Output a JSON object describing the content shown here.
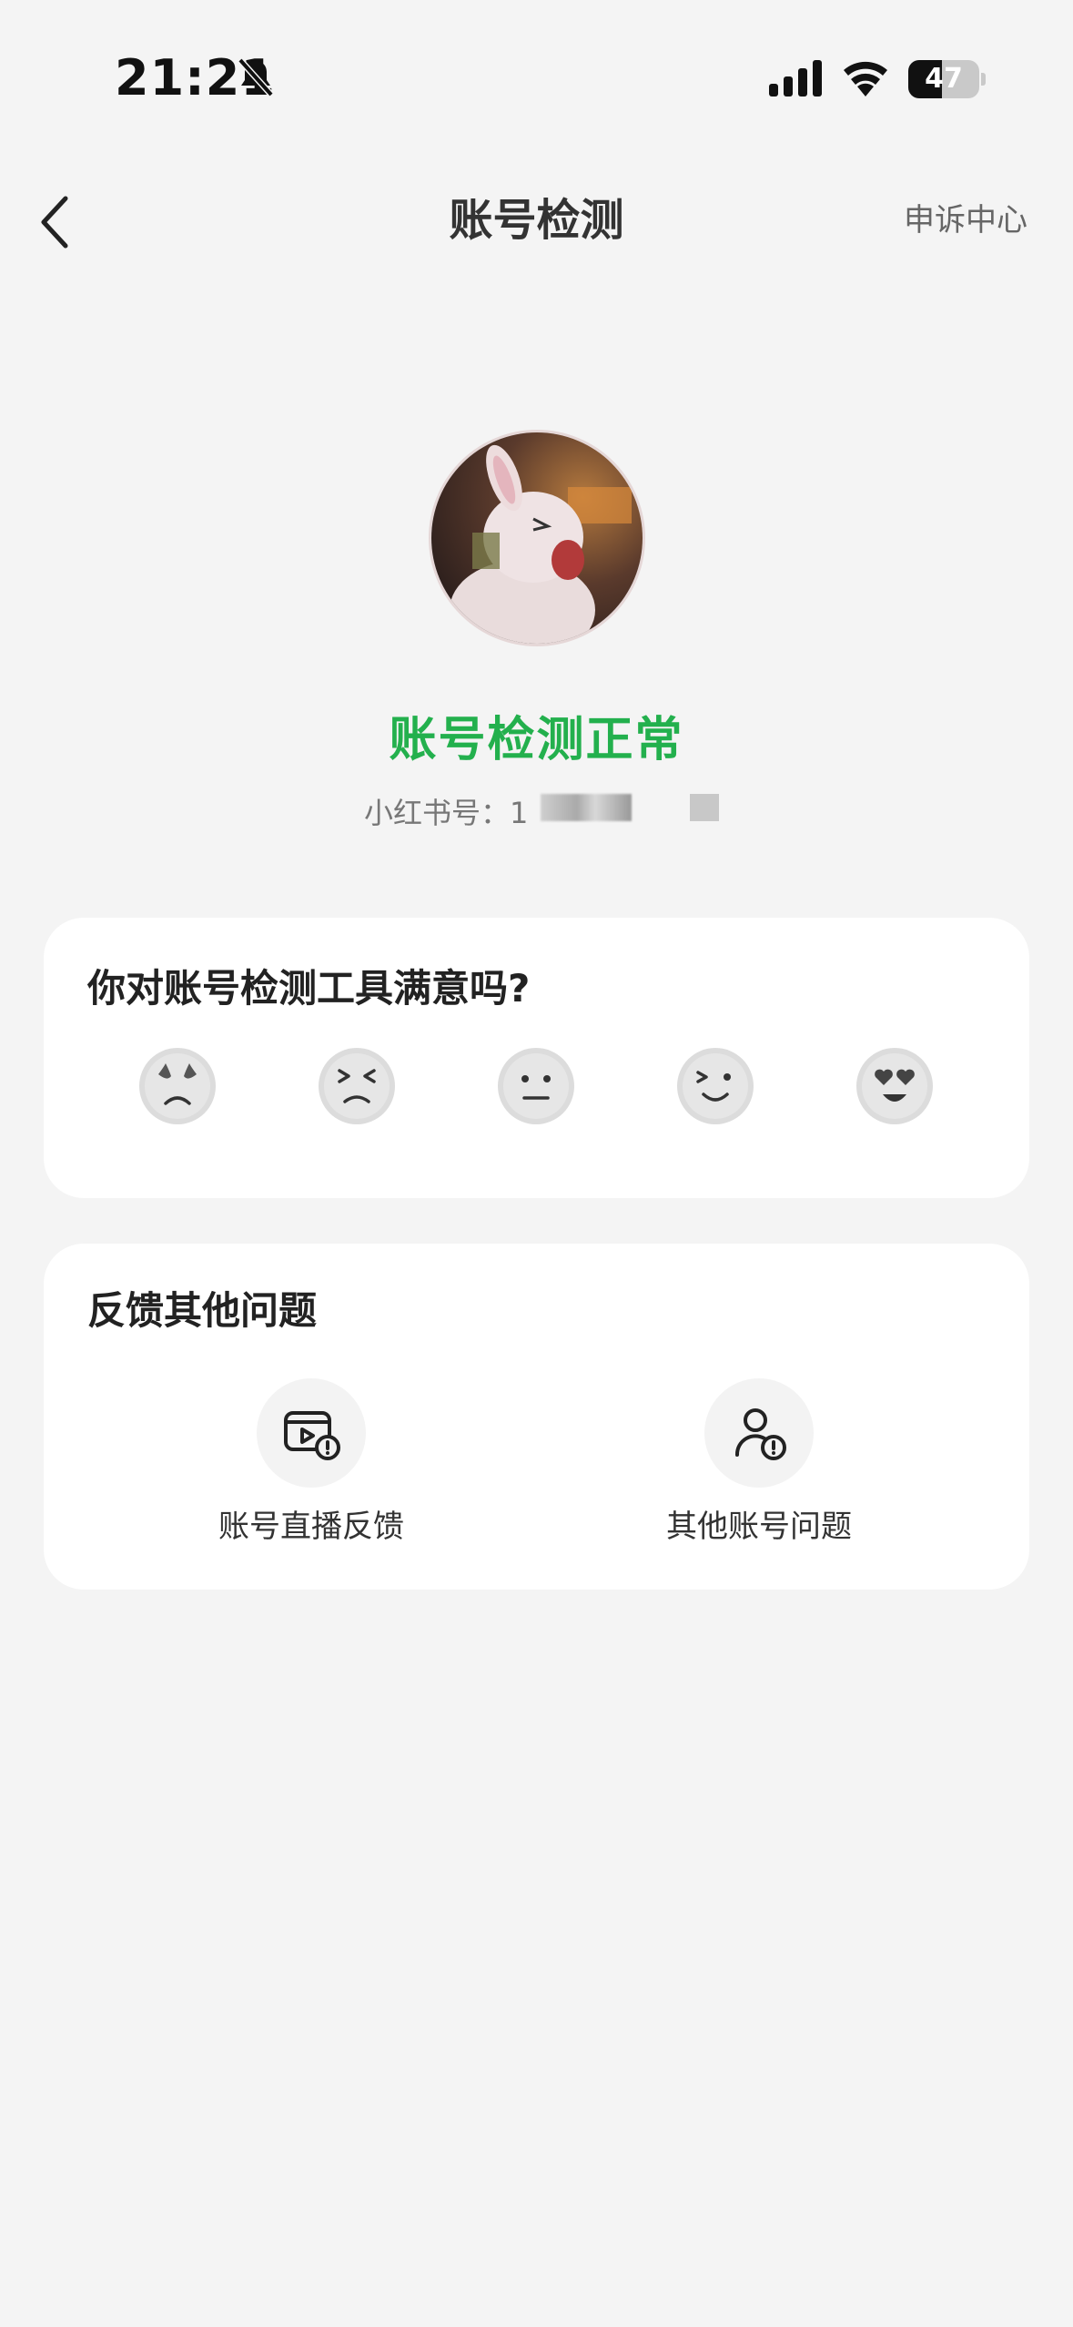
{
  "status_bar": {
    "time": "21:21",
    "battery": "47",
    "battery_level": 0.47
  },
  "nav": {
    "title": "账号检测",
    "right_link": "申诉中心"
  },
  "profile": {
    "status": "账号检测正常",
    "account_id_label": "小红书号：",
    "account_id_visible": "1"
  },
  "satisfaction": {
    "question": "你对账号检测工具满意吗?",
    "ratings": [
      "very-unsatisfied-face-icon",
      "unsatisfied-face-icon",
      "neutral-face-icon",
      "satisfied-face-icon",
      "very-satisfied-face-icon"
    ]
  },
  "feedback": {
    "title": "反馈其他问题",
    "items": [
      {
        "label": "账号直播反馈",
        "icon": "live-stream-alert-icon"
      },
      {
        "label": "其他账号问题",
        "icon": "user-alert-icon"
      }
    ]
  },
  "colors": {
    "status_ok": "#23b04d",
    "background": "#f4f4f4",
    "card": "#ffffff"
  }
}
